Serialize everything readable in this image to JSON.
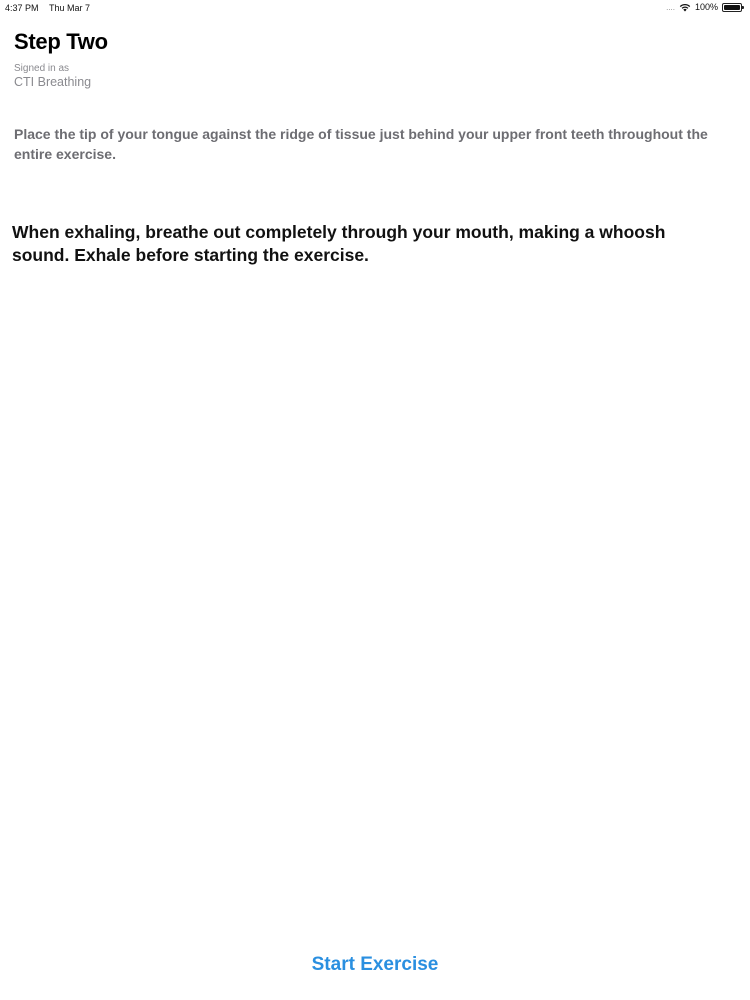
{
  "status_bar": {
    "time": "4:37 PM",
    "date": "Thu Mar 7",
    "signal": "....",
    "battery": "100%",
    "battery_level": 1.0
  },
  "header": {
    "title": "Step Two",
    "signed_in_label": "Signed in as",
    "signed_in_user": "CTI Breathing"
  },
  "content": {
    "instruction": "Place the tip of your tongue against the ridge of tissue just behind your upper front teeth throughout the entire exercise.",
    "main_instruction": "When exhaling, breathe out completely through your mouth, making a whoosh sound. Exhale before starting the exercise."
  },
  "actions": {
    "start_label": "Start Exercise"
  },
  "colors": {
    "accent": "#2a8fe0",
    "secondary_text": "#6d6d72",
    "muted_text": "#8a8a8f"
  }
}
